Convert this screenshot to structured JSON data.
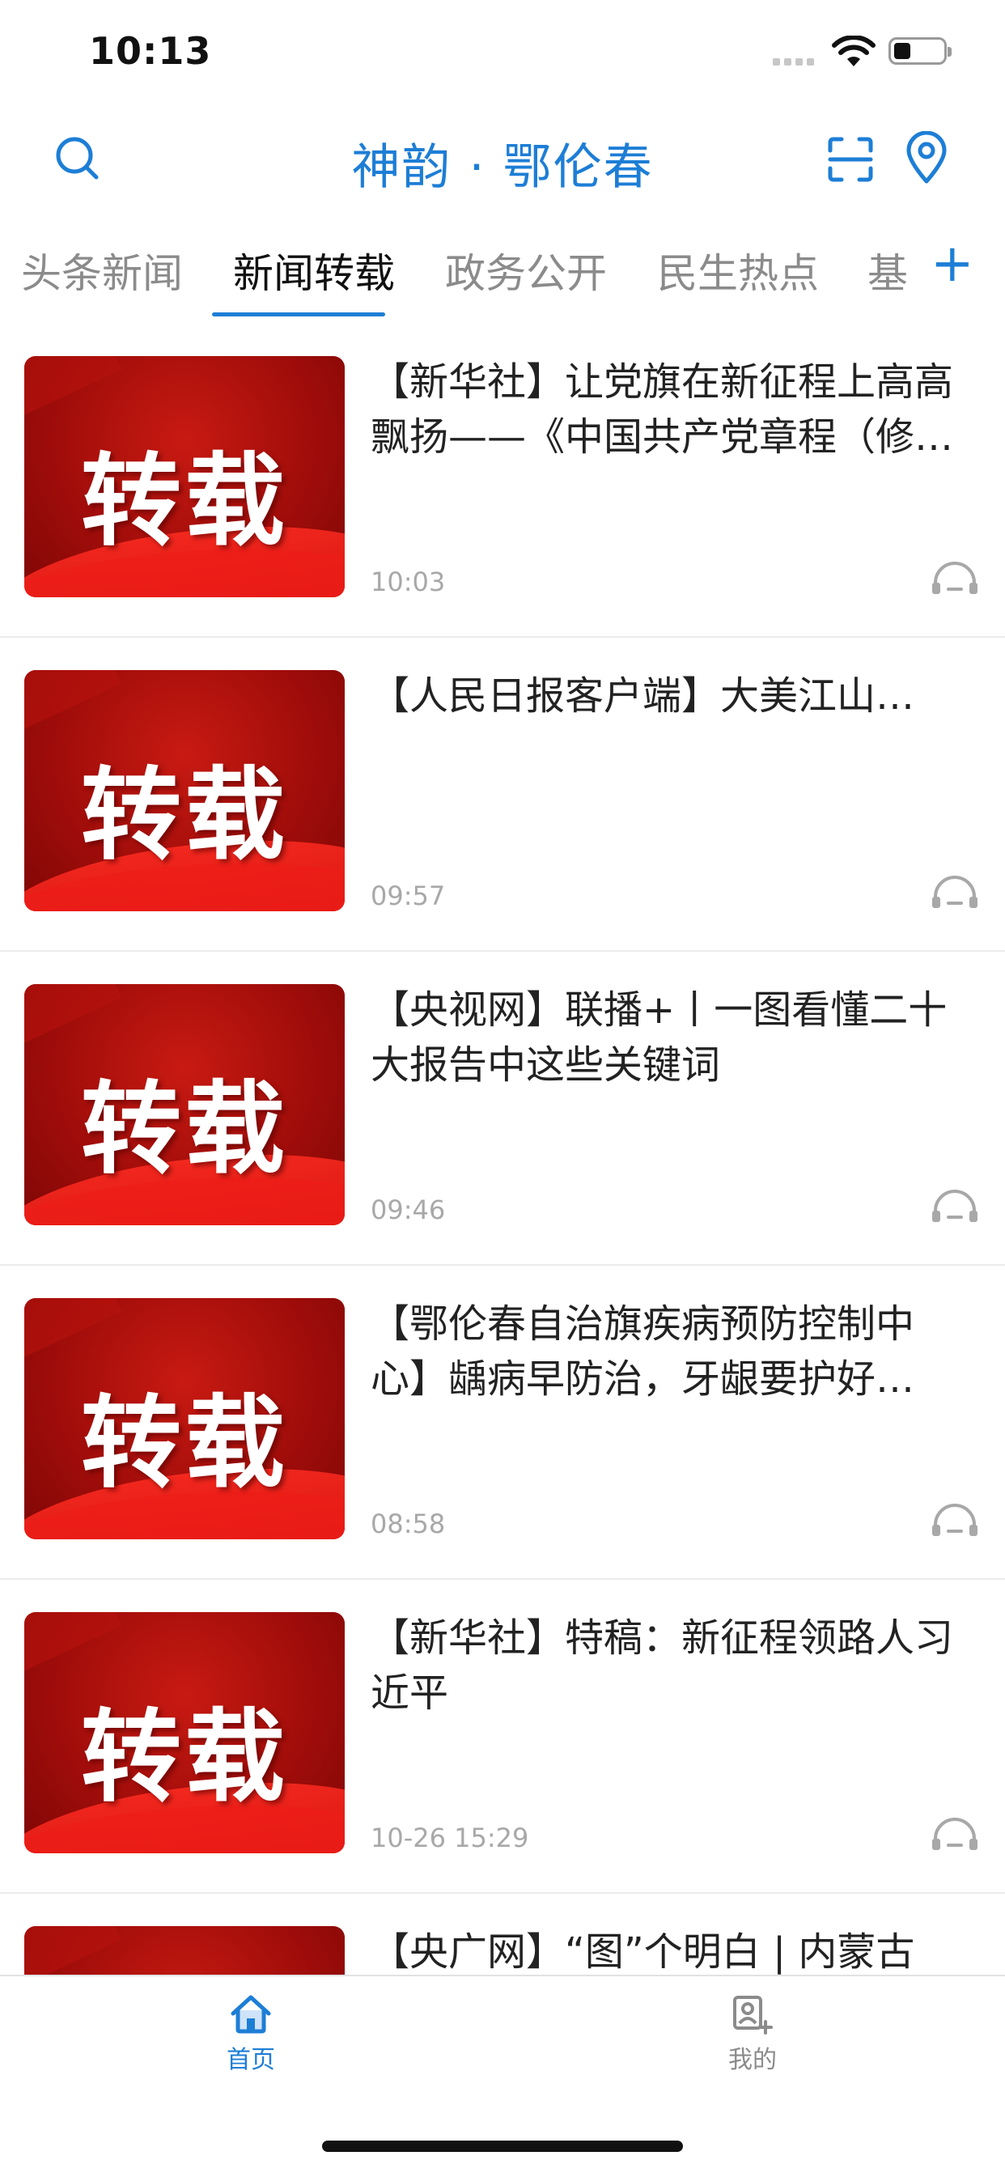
{
  "status_bar": {
    "time": "10:13",
    "battery_level": 0.35
  },
  "header": {
    "title": "神韵 · 鄂伦春",
    "accent_color": "#1d7ed6",
    "icons": [
      "search-icon",
      "scan-icon",
      "location-icon"
    ]
  },
  "tabs": {
    "items": [
      "头条新闻",
      "新闻转载",
      "政务公开",
      "民生热点",
      "基"
    ],
    "active_index": 1,
    "add_label": "+"
  },
  "articles": [
    {
      "thumb_label": "转载",
      "title": "【新华社】让党旗在新征程上高高飘扬——《中国共产党章程（修正案）》诞生记",
      "time": "10:03"
    },
    {
      "thumb_label": "转载",
      "title": "【人民日报客户端】大美江山…",
      "time": "09:57"
    },
    {
      "thumb_label": "转载",
      "title": "【央视网】联播+丨一图看懂二十大报告中这些关键词",
      "time": "09:46"
    },
    {
      "thumb_label": "转载",
      "title": "【鄂伦春自治旗疾病预防控制中心】龋病早防治，牙龈要护好…",
      "time": "08:58"
    },
    {
      "thumb_label": "转载",
      "title": "【新华社】特稿：新征程领路人习近平",
      "time": "10-26 15:29"
    },
    {
      "thumb_label": "转载",
      "title": "【央广网】“图”个明白 | 内蒙古",
      "time": ""
    }
  ],
  "bottom_nav": {
    "items": [
      {
        "label": "首页",
        "icon": "home-icon",
        "active": true
      },
      {
        "label": "我的",
        "icon": "profile-add-icon",
        "active": false
      }
    ],
    "active_color": "#1d7ed6",
    "inactive_color": "#8b8b8b"
  }
}
